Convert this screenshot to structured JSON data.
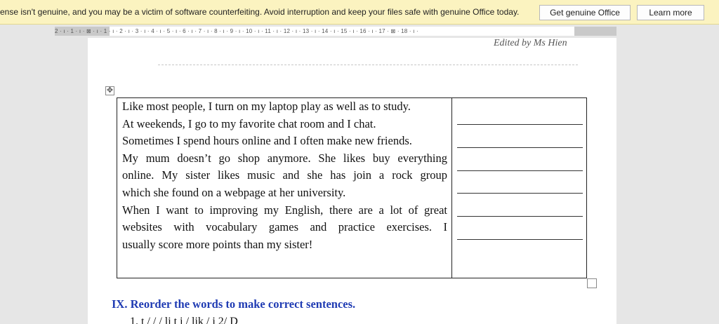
{
  "license_bar": {
    "message": "ense isn't genuine, and you may be a victim of software counterfeiting. Avoid interruption and keep your files safe with genuine Office today.",
    "get_genuine_label": "Get genuine Office",
    "learn_more_label": "Learn more"
  },
  "ruler": {
    "text": "2 · ı · 1 · ı · ⊠ · ı · 1 · ı · 2 · ı · 3 · ı · 4 · ı · 5 · ı · 6 · ı · 7 · ı · 8 · ı · 9 · ı · 10 · ı · 11 · ı · 12 · ı · 13 · ı · 14 · ı · 15 · ı · 16 · ı · 17 · ⊠ · 18 · ı ·"
  },
  "document": {
    "header": "Edited by Ms Hien",
    "passage_lines": [
      "Like most people, I turn on my laptop play as well as to study.",
      "At weekends, I go to my favorite chat room and I chat.",
      "Sometimes I spend hours online and I often make new friends.",
      "My mum doesn’t go shop anymore. She likes buy everything",
      "online. My sister likes music and she has join a rock group",
      "which she found on a webpage at her university.",
      "When I want to improving my English, there are a lot of great",
      "websites with vocabulary games and practice exercises. I",
      "usually score more points than my sister!"
    ],
    "answer_line_count": 6,
    "section_heading": "IX. Reorder the words to make correct sentences.",
    "next_item": "1. t / / / li t i / lik / i 2/ D"
  }
}
